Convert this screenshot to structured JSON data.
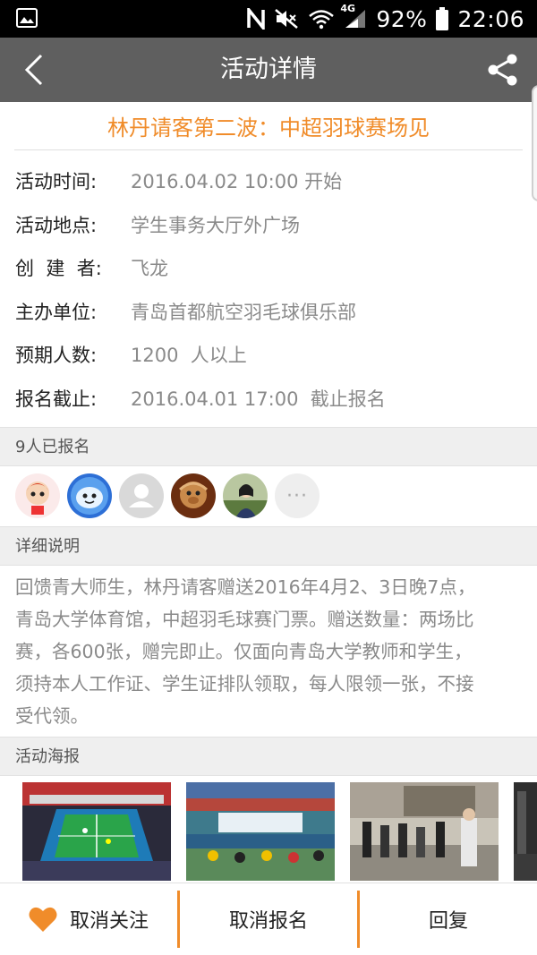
{
  "status_bar": {
    "battery": "92%",
    "time": "22:06",
    "network": "4G"
  },
  "header": {
    "title": "活动详情"
  },
  "event": {
    "title": "林丹请客第二波：中超羽球赛场见",
    "info": [
      {
        "label": "活动时间:",
        "value": "2016.04.02 10:00  开始"
      },
      {
        "label": "活动地点:",
        "value": "学生事务大厅外广场"
      },
      {
        "label": "创  建  者:",
        "value": "飞龙"
      },
      {
        "label": "主办单位:",
        "value": "青岛首都航空羽毛球俱乐部"
      },
      {
        "label": "预期人数:",
        "value": "1200  人以上"
      },
      {
        "label": "报名截止:",
        "value": "2016.04.01 17:00  截止报名"
      }
    ]
  },
  "signups": {
    "heading": "9人已报名",
    "more": "···"
  },
  "details": {
    "heading": "详细说明",
    "lines": [
      "回馈青大师生，林丹请客赠送2016年4月2、3日晚7点，",
      "青岛大学体育馆，中超羽毛球赛门票。赠送数量：两场比",
      "赛，各600张，赠完即止。仅面向青岛大学教师和学生，",
      "须持本人工作证、学生证排队领取，每人限领一张，不接",
      "受代领。"
    ]
  },
  "posters": {
    "heading": "活动海报"
  },
  "bottom_bar": {
    "unfollow": "取消关注",
    "cancel_signup": "取消报名",
    "reply": "回复"
  },
  "colors": {
    "accent": "#f08c2a",
    "header_bg": "#5f5f5f",
    "section_bg": "#efefef"
  }
}
